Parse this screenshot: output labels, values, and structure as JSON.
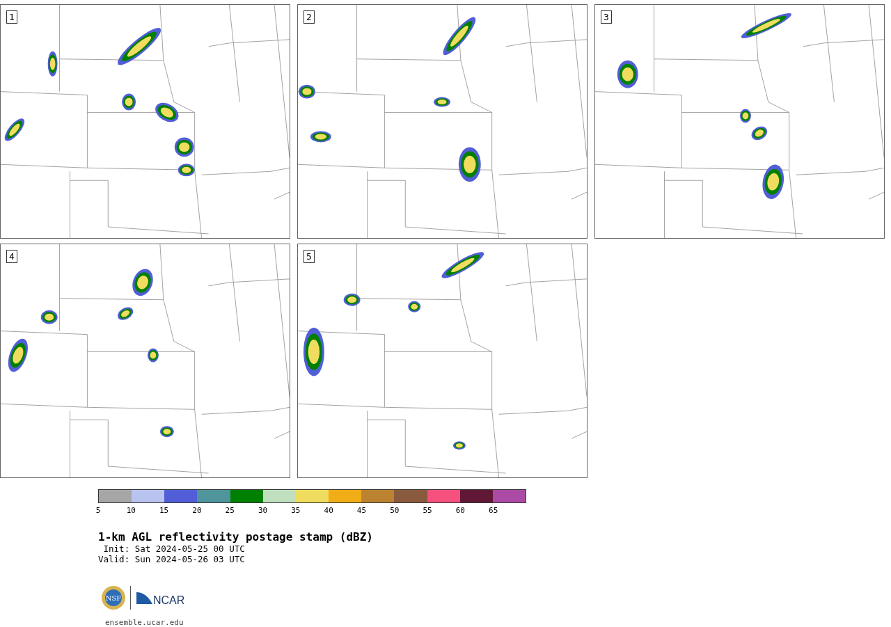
{
  "panels": [
    {
      "label": "1"
    },
    {
      "label": "2"
    },
    {
      "label": "3"
    },
    {
      "label": "4"
    },
    {
      "label": "5"
    }
  ],
  "colorbar": [
    {
      "label": "5",
      "color": "#a6a6a6"
    },
    {
      "label": "10",
      "color": "#b8c3ef"
    },
    {
      "label": "15",
      "color": "#525ed7"
    },
    {
      "label": "20",
      "color": "#4f959b"
    },
    {
      "label": "25",
      "color": "#008000"
    },
    {
      "label": "30",
      "color": "#bfdfbf"
    },
    {
      "label": "35",
      "color": "#f0dc5f"
    },
    {
      "label": "40",
      "color": "#f0ad16"
    },
    {
      "label": "45",
      "color": "#bb8330"
    },
    {
      "label": "50",
      "color": "#8a5a3f"
    },
    {
      "label": "55",
      "color": "#f5507e"
    },
    {
      "label": "60",
      "color": "#611837"
    },
    {
      "label": "65",
      "color": "#ac4ba6"
    }
  ],
  "title": "1-km AGL reflectivity postage stamp (dBZ)",
  "init": " Init: Sat 2024-05-25 00 UTC",
  "valid": "Valid: Sun 2024-05-26 03 UTC",
  "logos": {
    "nsf": "NSF",
    "ncar": "NCAR"
  },
  "site": "ensemble.ucar.edu"
}
